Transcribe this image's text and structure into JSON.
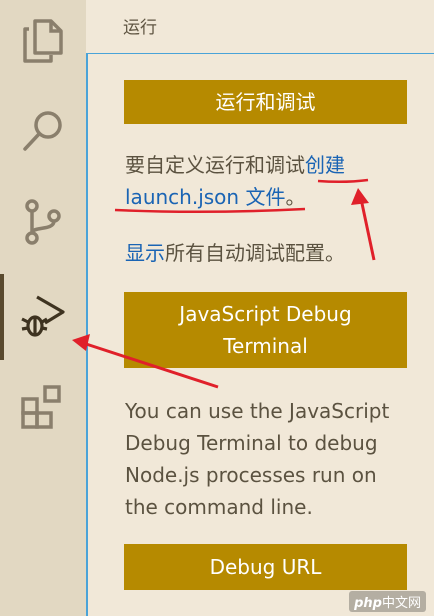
{
  "activity_bar": {
    "items": [
      {
        "icon": "files-icon"
      },
      {
        "icon": "search-icon"
      },
      {
        "icon": "source-control-icon"
      },
      {
        "icon": "run-debug-icon",
        "active": true
      },
      {
        "icon": "extensions-icon"
      }
    ]
  },
  "panel": {
    "title": "运行",
    "run_debug_button": "运行和调试",
    "customize_prefix": "要自定义运行和调试",
    "create_link": "创建",
    "launch_link": "launch.json 文件",
    "customize_suffix": "。",
    "show_all_link": "显示",
    "show_all_suffix": "所有自动调试配置。",
    "js_debug_button_line1": "JavaScript Debug",
    "js_debug_button_line2": "Terminal",
    "js_debug_description": "You can use the JavaScript Debug Terminal to debug Node.js processes run on the command line.",
    "debug_url_button": "Debug URL"
  },
  "watermark": {
    "brand": "php",
    "suffix": "中文网"
  },
  "colors": {
    "accent": "#b68a00",
    "link": "#1a64b4",
    "annotation": "#e0202a",
    "focus_border": "#4aa3d8"
  }
}
